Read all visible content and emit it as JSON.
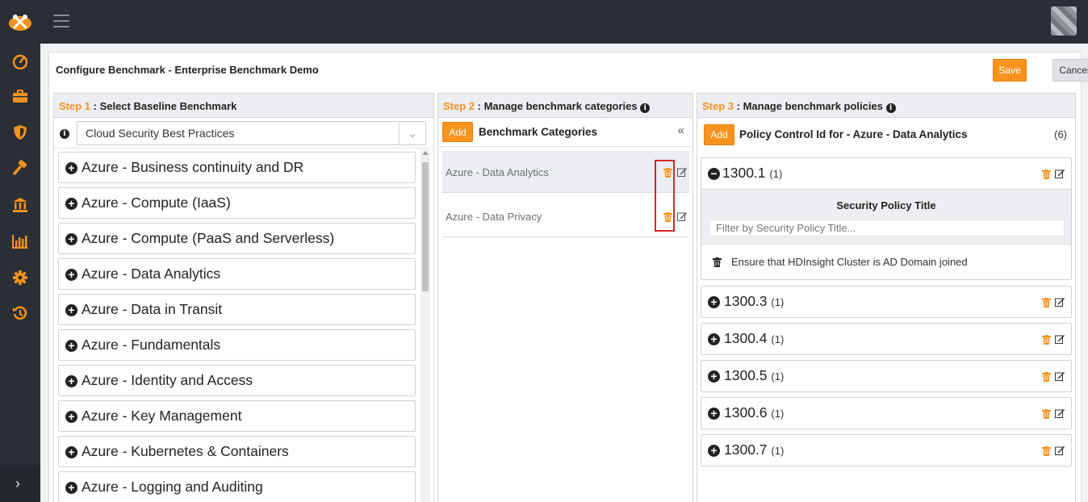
{
  "app": {
    "name": "Configure Benchmark"
  },
  "topbar": {
    "menu_icon": "hamburger-icon",
    "avatar": "user-avatar"
  },
  "sidebar": {
    "items": [
      {
        "name": "dashboard",
        "icon": "speedometer-icon"
      },
      {
        "name": "briefcase",
        "icon": "briefcase-icon"
      },
      {
        "name": "shield",
        "icon": "shield-icon"
      },
      {
        "name": "tools",
        "icon": "hammer-icon"
      },
      {
        "name": "bank",
        "icon": "bank-icon"
      },
      {
        "name": "reports",
        "icon": "bar-chart-icon"
      },
      {
        "name": "settings",
        "icon": "gear-icon"
      },
      {
        "name": "history",
        "icon": "history-icon"
      }
    ],
    "expand_icon": "chevron-right-icon"
  },
  "colors": {
    "accent": "#f7931e",
    "sidebar": "#2b2f35",
    "highlight": "#d9262b"
  },
  "page": {
    "title": "Configure Benchmark - Enterprise Benchmark Demo",
    "save_label": "Save",
    "cancel_label": "Cancel"
  },
  "step1": {
    "step": "Step 1",
    "title": " : Select Baseline Benchmark",
    "selected_benchmark": "Cloud Security Best Practices",
    "items": [
      "Azure - Business continuity and DR",
      "Azure - Compute (IaaS)",
      "Azure - Compute (PaaS and Serverless)",
      "Azure - Data Analytics",
      "Azure - Data in Transit",
      "Azure - Fundamentals",
      "Azure - Identity and Access",
      "Azure - Key Management",
      "Azure - Kubernetes & Containers",
      "Azure - Logging and Auditing"
    ]
  },
  "step2": {
    "step": "Step 2",
    "title": " : Manage benchmark categories",
    "add_label": "Add",
    "list_title": "Benchmark Categories",
    "collapse_label": "«",
    "categories": [
      "Azure - Data Analytics",
      "Azure - Data Privacy"
    ]
  },
  "step3": {
    "step": "Step 3",
    "title": " : Manage benchmark policies",
    "add_label": "Add",
    "list_title": "Policy Control Id for - Azure - Data Analytics",
    "count": "(6)",
    "policies": [
      {
        "id": "1300.1",
        "count": "(1)"
      },
      {
        "id": "1300.3",
        "count": "(1)"
      },
      {
        "id": "1300.4",
        "count": "(1)"
      },
      {
        "id": "1300.5",
        "count": "(1)"
      },
      {
        "id": "1300.6",
        "count": "(1)"
      },
      {
        "id": "1300.7",
        "count": "(1)"
      }
    ],
    "expanded": {
      "column_title": "Security Policy Title",
      "filter_placeholder": "Filter by Security Policy Title...",
      "entry": "Ensure that HDInsight Cluster is AD Domain joined"
    }
  }
}
